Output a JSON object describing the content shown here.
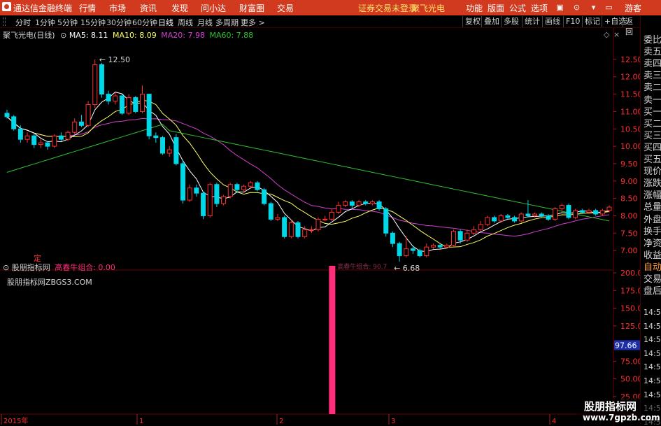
{
  "menubar": {
    "app_title": "通达信金融终端",
    "menus": [
      "行情",
      "市场",
      "资讯",
      "发现",
      "问小达",
      "财富圈",
      "交易"
    ],
    "notice": "证券交易未登录",
    "stock_name": "聚飞光电",
    "right_items": [
      "功能",
      "版面",
      "公式",
      "选项"
    ],
    "guest": "游客"
  },
  "periodbar": {
    "periods": [
      "分时",
      "1分钟",
      "5分钟",
      "15分钟",
      "30分钟",
      "60分钟",
      "日线",
      "周线",
      "月线",
      "多周期",
      "更多 >"
    ],
    "active_period": "日线",
    "buttons": [
      "复权",
      "叠加",
      "多股",
      "统计",
      "画线",
      "F10",
      "标记",
      "+自选",
      "返回"
    ]
  },
  "chart_header": {
    "title": "聚飞光电(日线)",
    "ma5": "MA5: 8.11",
    "ma10": "MA10: 8.09",
    "ma20": "MA20: 7.98",
    "ma60": "MA60: 7.88",
    "high_label": "12.50",
    "low_label": "6.68",
    "marker": "定"
  },
  "indicator_header": {
    "name": "股朋指标网",
    "series_label": "高春牛组合: 0.00",
    "site_text": "股朋指标网ZBGS3.COM",
    "bar_label": "高春牛组合: 90.7"
  },
  "axes": {
    "price_ticks": [
      "12.50",
      "12.00",
      "11.50",
      "11.00",
      "10.50",
      "10.00",
      "9.50",
      "9.00",
      "8.50",
      "8.00",
      "7.50",
      "7.00"
    ],
    "indicator_ticks": [
      "200.00",
      "175.00",
      "150.00",
      "125.00",
      "100.00",
      "75.00",
      "50.00",
      "25.00"
    ],
    "indicator_cursor": "97.66",
    "date_labels": [
      "2015年",
      "1",
      "2",
      "3",
      "4"
    ]
  },
  "right_panel": {
    "labels": [
      "委比",
      "卖五",
      "卖四",
      "卖三",
      "卖二",
      "卖一",
      "买一",
      "买二",
      "买三",
      "买四",
      "买五",
      "现价",
      "涨跌",
      "涨幅",
      "总量",
      "外盘",
      "换手",
      "净资",
      "收益",
      "自动",
      "交易",
      "盘后"
    ],
    "times": [
      "14:56",
      "14:56",
      "14:56",
      "14:56",
      "14:56",
      "14:56",
      "14:56",
      "14:56",
      "14:56"
    ]
  },
  "watermark": {
    "line1": "股朋指标网",
    "line2": "www.7gpzb.com"
  },
  "colors": {
    "up": "#ff3030",
    "down": "#00d8e8",
    "ma5": "#ffffff",
    "ma10": "#ffff66",
    "ma20": "#d040d0",
    "ma60": "#30c030",
    "indicator_bar": "#ff2d7a",
    "menubar_bg": "#d13a1e",
    "grid": "#6a0000"
  },
  "chart_data": {
    "type": "candlestick",
    "title": "聚飞光电(日线)",
    "x_labels": [
      "2015年",
      "1",
      "2",
      "3",
      "4"
    ],
    "ylim": [
      6.6,
      12.8
    ],
    "candles": [
      [
        10.95,
        10.85,
        11.05,
        10.8
      ],
      [
        10.85,
        10.5,
        10.9,
        10.45
      ],
      [
        10.5,
        10.2,
        10.6,
        10.1
      ],
      [
        10.2,
        10.3,
        10.4,
        10.1
      ],
      [
        10.3,
        10.05,
        10.35,
        9.95
      ],
      [
        10.05,
        10.1,
        10.2,
        9.95
      ],
      [
        10.1,
        10.0,
        10.15,
        9.9
      ],
      [
        10.0,
        10.3,
        10.35,
        9.95
      ],
      [
        10.3,
        10.2,
        10.4,
        10.15
      ],
      [
        10.2,
        10.4,
        10.45,
        10.15
      ],
      [
        10.4,
        10.7,
        10.8,
        10.35
      ],
      [
        10.7,
        10.6,
        10.9,
        10.55
      ],
      [
        10.6,
        11.2,
        11.3,
        10.55
      ],
      [
        11.2,
        12.35,
        12.5,
        11.1
      ],
      [
        12.35,
        11.5,
        12.4,
        11.4
      ],
      [
        11.5,
        11.3,
        11.6,
        11.2
      ],
      [
        11.3,
        11.45,
        11.55,
        11.2
      ],
      [
        11.45,
        10.95,
        11.5,
        10.9
      ],
      [
        10.95,
        11.4,
        11.5,
        10.9
      ],
      [
        11.4,
        11.0,
        11.45,
        10.95
      ],
      [
        11.0,
        11.5,
        11.75,
        10.95
      ],
      [
        11.5,
        10.3,
        11.5,
        10.2
      ],
      [
        10.3,
        10.25,
        10.4,
        10.1
      ],
      [
        10.25,
        9.8,
        10.3,
        9.75
      ],
      [
        9.8,
        9.9,
        10.0,
        9.7
      ],
      [
        10.25,
        9.5,
        10.35,
        9.45
      ],
      [
        9.5,
        8.45,
        9.6,
        8.35
      ],
      [
        8.45,
        8.8,
        8.9,
        8.4
      ],
      [
        8.8,
        8.65,
        8.9,
        8.55
      ],
      [
        8.65,
        8.0,
        8.7,
        7.9
      ],
      [
        8.0,
        8.9,
        8.95,
        7.95
      ],
      [
        8.9,
        8.35,
        8.95,
        8.25
      ],
      [
        8.35,
        8.55,
        8.6,
        8.3
      ],
      [
        8.55,
        8.9,
        8.95,
        8.5
      ],
      [
        8.9,
        8.75,
        8.95,
        8.65
      ],
      [
        8.75,
        8.85,
        8.9,
        8.7
      ],
      [
        8.85,
        8.95,
        9.0,
        8.8
      ],
      [
        8.95,
        8.75,
        9.0,
        8.7
      ],
      [
        8.75,
        8.35,
        8.8,
        8.3
      ],
      [
        8.35,
        7.9,
        8.4,
        7.85
      ],
      [
        7.9,
        7.95,
        8.05,
        7.85
      ],
      [
        7.95,
        7.4,
        8.0,
        7.35
      ],
      [
        7.4,
        7.8,
        7.9,
        7.35
      ],
      [
        7.8,
        7.4,
        7.85,
        7.35
      ],
      [
        7.4,
        7.6,
        7.7,
        7.35
      ],
      [
        7.6,
        7.6,
        7.7,
        7.5
      ],
      [
        7.6,
        7.9,
        7.95,
        7.55
      ],
      [
        7.9,
        7.9,
        8.0,
        7.85
      ],
      [
        7.9,
        8.1,
        8.2,
        7.85
      ],
      [
        8.1,
        8.3,
        8.4,
        8.05
      ],
      [
        8.3,
        8.4,
        8.45,
        8.25
      ],
      [
        8.4,
        8.3,
        8.45,
        8.2
      ],
      [
        8.3,
        8.4,
        8.45,
        8.25
      ],
      [
        8.4,
        8.35,
        8.45,
        8.3
      ],
      [
        8.35,
        8.4,
        8.45,
        8.3
      ],
      [
        8.4,
        8.2,
        8.45,
        8.15
      ],
      [
        8.2,
        7.5,
        8.25,
        7.4
      ],
      [
        7.5,
        7.2,
        7.55,
        7.1
      ],
      [
        7.2,
        6.85,
        7.25,
        6.68
      ],
      [
        6.85,
        7.05,
        7.4,
        6.8
      ],
      [
        7.05,
        7.0,
        7.15,
        6.9
      ],
      [
        7.0,
        6.85,
        7.05,
        6.8
      ],
      [
        6.85,
        7.1,
        7.2,
        6.8
      ],
      [
        7.1,
        7.15,
        7.2,
        7.05
      ],
      [
        7.15,
        7.1,
        7.2,
        7.05
      ],
      [
        7.1,
        7.15,
        7.2,
        7.05
      ],
      [
        7.15,
        7.55,
        7.6,
        7.1
      ],
      [
        7.55,
        7.3,
        7.6,
        7.2
      ],
      [
        7.3,
        7.5,
        7.6,
        7.25
      ],
      [
        7.5,
        7.6,
        7.7,
        7.45
      ],
      [
        7.6,
        7.75,
        7.85,
        7.55
      ],
      [
        7.75,
        7.95,
        8.0,
        7.7
      ],
      [
        7.95,
        7.85,
        8.0,
        7.8
      ],
      [
        7.85,
        8.0,
        8.05,
        7.8
      ],
      [
        8.0,
        7.95,
        8.05,
        7.9
      ],
      [
        7.95,
        7.85,
        8.0,
        7.8
      ],
      [
        7.85,
        8.05,
        8.1,
        7.8
      ],
      [
        8.05,
        8.0,
        8.45,
        7.95
      ],
      [
        8.0,
        8.05,
        8.1,
        7.95
      ],
      [
        8.05,
        8.0,
        8.1,
        7.95
      ],
      [
        8.0,
        7.9,
        8.05,
        7.85
      ],
      [
        7.9,
        8.2,
        8.25,
        7.85
      ],
      [
        8.2,
        8.3,
        8.35,
        8.15
      ],
      [
        8.3,
        7.95,
        8.35,
        7.9
      ],
      [
        7.95,
        8.15,
        8.2,
        7.9
      ],
      [
        8.15,
        8.1,
        8.2,
        8.05
      ],
      [
        8.1,
        8.15,
        8.2,
        8.05
      ],
      [
        8.15,
        8.05,
        8.2,
        8.0
      ],
      [
        8.05,
        8.15,
        8.2,
        8.0
      ],
      [
        8.15,
        8.25,
        8.3,
        8.1
      ]
    ],
    "indicator": {
      "name": "高春牛组合",
      "ylim": [
        0,
        210
      ],
      "bars": [
        {
          "index": 48,
          "value": 210
        }
      ]
    }
  }
}
